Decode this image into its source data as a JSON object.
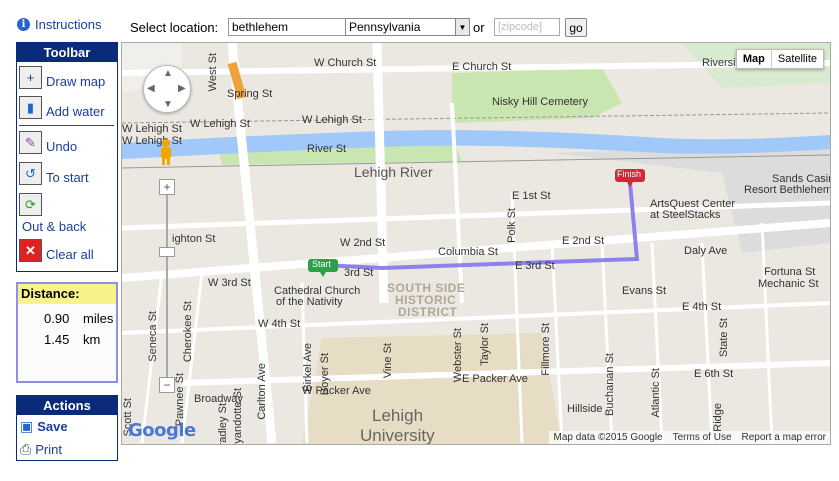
{
  "header": {
    "instructions_label": "Instructions",
    "select_location_label": "Select location:",
    "city_value": "bethlehem",
    "state_value": "Pennsylvania",
    "or_label": "or",
    "zip_placeholder": "[zipcode]",
    "go_label": "go"
  },
  "toolbar": {
    "title": "Toolbar",
    "draw_map": "Draw map",
    "add_water": "Add water",
    "undo": "Undo",
    "to_start": "To start",
    "out_back": "Out & back",
    "clear_all": "Clear all"
  },
  "distance": {
    "title": "Distance:",
    "miles_value": "0.90",
    "miles_unit": "miles",
    "km_value": "1.45",
    "km_unit": "km"
  },
  "actions": {
    "title": "Actions",
    "save": "Save",
    "print": "Print"
  },
  "map": {
    "type_map": "Map",
    "type_satellite": "Satellite",
    "start_marker": "Start",
    "finish_marker": "Finish",
    "attribution": "Map data ©2015 Google",
    "terms": "Terms of Use",
    "report": "Report a map error",
    "google_logo": "Google",
    "route_color": "#7b6ef0",
    "water_color": "#a0c8f8",
    "park_color": "#c9e5b0",
    "labels": {
      "w_church": "W Church St",
      "e_church": "E Church St",
      "spring": "Spring St",
      "west_st": "West St",
      "nisky": "Nisky Hill Cemetery",
      "riverside": "Riverside",
      "w_lehigh": "W Lehigh St",
      "w_lehigh2": "W Lehigh St",
      "w_lehigh3": "W Lehigh St",
      "w_lehigh4": "W Lehigh St",
      "river_st": "River St",
      "lehigh_river": "Lehigh River",
      "sands": "Sands Casino",
      "resort": "Resort Bethlehem",
      "e_1st": "E 1st St",
      "artsquest": "ArtsQuest Center",
      "steelstacks": "at SteelStacks",
      "polk": "Polk St",
      "w_2nd": "W 2nd St",
      "columbia": "Columbia St",
      "e_2nd": "E 2nd St",
      "daly": "Daly Ave",
      "ighton": "ighton St",
      "w_3rd": "W 3rd St",
      "rd_st": "3rd St",
      "e_3rd": "E 3rd St",
      "fortuna": "Fortuna St",
      "mechanic": "Mechanic St",
      "evans": "Evans St",
      "cathedral": "Cathedral Church",
      "nativity": "of the Nativity",
      "south_side1": "SOUTH SIDE",
      "south_side2": "HISTORIC",
      "south_side3": "DISTRICT",
      "w_4th": "W 4th St",
      "e_4th": "E 4th St",
      "seneca": "Seneca St",
      "cherokee": "Cherokee St",
      "birkel": "Birkel Ave",
      "boyer": "Boyer St",
      "vine": "Vine St",
      "webster": "Webster St",
      "taylor": "Taylor St",
      "fillmore": "Fillmore St",
      "buchanan": "Buchanan St",
      "atlantic": "Atlantic St",
      "state": "State St",
      "e_6th": "E 6th St",
      "e_packer": "E Packer Ave",
      "w_packer": "W Packer Ave",
      "carlton": "Carlton Ave",
      "pawnee": "Pawnee St",
      "broadway": "Broadway",
      "bradley": "Bradley St",
      "wyandotte": "Wyandotte St",
      "hillside": "Hillside",
      "ridge": "Ridge",
      "lehigh_u1": "Lehigh",
      "lehigh_u2": "University",
      "scott": "Scott St"
    }
  }
}
